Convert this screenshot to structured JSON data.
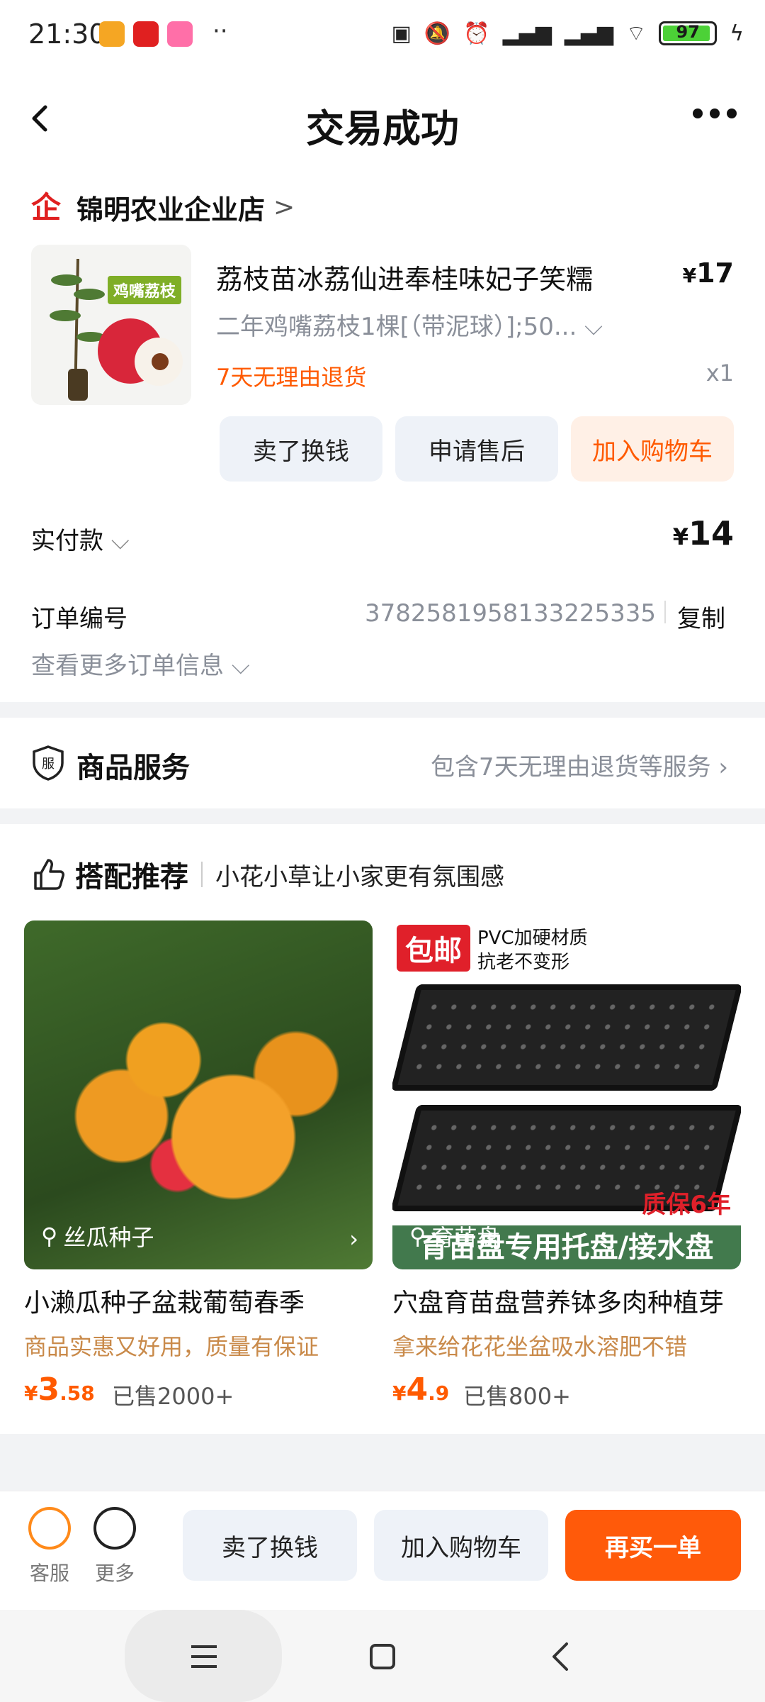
{
  "status_bar": {
    "time": "21:30",
    "battery": "97"
  },
  "header": {
    "title": "交易成功"
  },
  "shop": {
    "name": "锦明农业企业店",
    "chevron": ">"
  },
  "product": {
    "image_tag": "鸡嘴荔枝",
    "name": "荔枝苗冰荔仙进奉桂味妃子笑糯",
    "price_symbol": "¥",
    "price": "17",
    "spec": "二年鸡嘴荔枝1棵[（带泥球）];50...",
    "return_policy": "7天无理由退货",
    "quantity": "x1"
  },
  "actions": {
    "sell": "卖了换钱",
    "after_sale": "申请售后",
    "add_cart": "加入购物车"
  },
  "payment": {
    "label": "实付款",
    "symbol": "¥",
    "amount": "14"
  },
  "order": {
    "number_label": "订单编号",
    "number": "3782581958133225335",
    "copy": "复制",
    "more_info": "查看更多订单信息"
  },
  "service": {
    "icon_text": "服",
    "title": "商品服务",
    "desc": "包含7天无理由退货等服务"
  },
  "recommend": {
    "title": "搭配推荐",
    "subtitle": "小花小草让小家更有氛围感",
    "items": [
      {
        "search_text": "丝瓜种子",
        "name": "小濑瓜种子盆栽葡萄春季",
        "desc": "商品实惠又好用，质量有保证",
        "price_int": "3",
        "price_dec": ".58",
        "sold": "已售2000+"
      },
      {
        "badge": "包邮",
        "feature_line1": "PVC加硬材质",
        "feature_line2": "抗老不变形",
        "warranty": "质保6年",
        "banner": "育苗盘专用托盘/接水盘",
        "search_text": "育苗盘",
        "name": "穴盘育苗盘营养钵多肉种植芽",
        "desc": "拿来给花花坐盆吸水溶肥不错",
        "price_int": "4",
        "price_dec": ".9",
        "sold": "已售800+"
      }
    ]
  },
  "bottom_bar": {
    "service_label": "客服",
    "more_label": "更多",
    "sell": "卖了换钱",
    "add_cart": "加入购物车",
    "rebuy": "再买一单"
  },
  "colors": {
    "accent": "#ff5a0a",
    "return_text": "#ff5a00",
    "muted": "#8a8f99"
  }
}
